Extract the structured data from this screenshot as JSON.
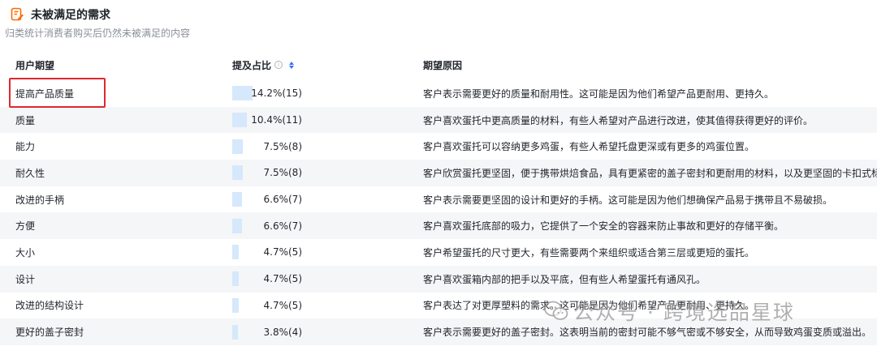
{
  "header": {
    "title": "未被满足的需求",
    "subtitle": "归类统计消费者购买后仍然未被满足的内容"
  },
  "columns": {
    "expect": "用户期望",
    "ratio": "提及占比",
    "reason": "期望原因"
  },
  "accent_color": "#3370ff",
  "bar_color": "#d6e8fb",
  "highlight_color": "#e0282e",
  "rows": [
    {
      "expect": "提高产品质量",
      "ratio": "14.2%(15)",
      "share": 14.2,
      "reason": "客户表示需要更好的质量和耐用性。这可能是因为他们希望产品更耐用、更持久。"
    },
    {
      "expect": "质量",
      "ratio": "10.4%(11)",
      "share": 10.4,
      "reason": "客户喜欢蛋托中更高质量的材料，有些人希望对产品进行改进，使其值得获得更好的评价。"
    },
    {
      "expect": "能力",
      "ratio": "7.5%(8)",
      "share": 7.5,
      "reason": "客户喜欢蛋托可以容纳更多鸡蛋，有些人希望托盘更深或有更多的鸡蛋位置。"
    },
    {
      "expect": "耐久性",
      "ratio": "7.5%(8)",
      "share": 7.5,
      "reason": "客户欣赏蛋托更坚固，便于携带烘焙食品，具有更紧密的盖子密封和更耐用的材料，以及更坚固的卡扣式标签。"
    },
    {
      "expect": "改进的手柄",
      "ratio": "6.6%(7)",
      "share": 6.6,
      "reason": "客户表示需要更坚固的设计和更好的手柄。这可能是因为他们想确保产品易于携带且不易破损。"
    },
    {
      "expect": "方便",
      "ratio": "6.6%(7)",
      "share": 6.6,
      "reason": "客户喜欢蛋托底部的吸力，它提供了一个安全的容器来防止事故和更好的存储平衡。"
    },
    {
      "expect": "大小",
      "ratio": "4.7%(5)",
      "share": 4.7,
      "reason": "客户希望蛋托的尺寸更大，有些需要两个来组织或适合第三层或更短的蛋托。"
    },
    {
      "expect": "设计",
      "ratio": "4.7%(5)",
      "share": 4.7,
      "reason": "客户喜欢蛋箱内部的把手以及平底，但有些人希望蛋托有通风孔。"
    },
    {
      "expect": "改进的结构设计",
      "ratio": "4.7%(5)",
      "share": 4.7,
      "reason": "客户表达了对更厚塑料的需求。这可能是因为他们希望产品更耐用、更持久。"
    },
    {
      "expect": "更好的盖子密封",
      "ratio": "3.8%(4)",
      "share": 3.8,
      "reason": "客户表示需要更好的盖子密封。这表明当前的密封可能不够气密或不够安全，从而导致鸡蛋变质或溢出。"
    }
  ],
  "watermark": {
    "text": "公众号 · 跨境选品星球",
    "icon": "wechat-icon"
  }
}
